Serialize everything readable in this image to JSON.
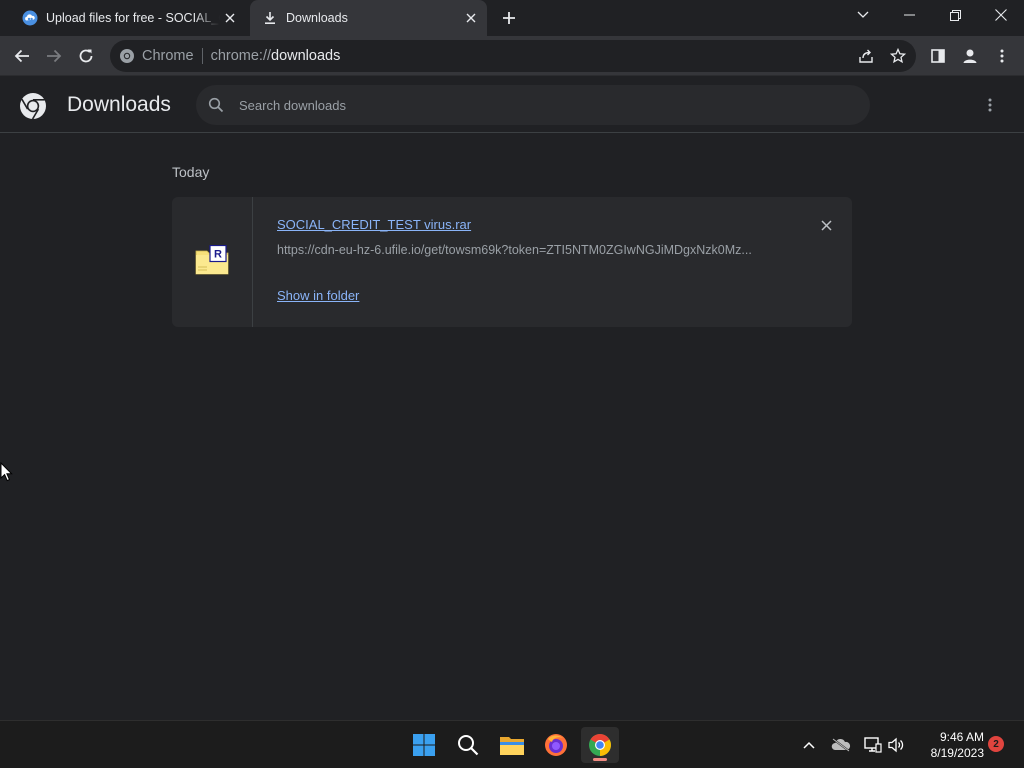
{
  "tabs": [
    {
      "title": "Upload files for free - SOCIAL_CREDIT_TEST virus.rar - ufile.io",
      "favicon": "ufile-cloud-icon",
      "active": false
    },
    {
      "title": "Downloads",
      "favicon": "download-icon",
      "active": true
    }
  ],
  "omnibox": {
    "site_chip": "Chrome",
    "scheme": "chrome://",
    "host": "downloads"
  },
  "page": {
    "title": "Downloads",
    "search_placeholder": "Search downloads"
  },
  "downloads": {
    "date_group": "Today",
    "items": [
      {
        "file_name": "SOCIAL_CREDIT_TEST virus.rar",
        "url": "https://cdn-eu-hz-6.ufile.io/get/towsm69k?token=ZTI5NTM0ZGIwNGJiMDgxNzk0Mz...",
        "action": "Show in folder",
        "file_icon": "rar-archive-icon"
      }
    ]
  },
  "taskbar": {
    "time": "9:46 AM",
    "date": "8/19/2023",
    "notifications": "2"
  },
  "colors": {
    "background": "#202124",
    "toolbar": "#35363a",
    "link": "#8ab4f8",
    "taskbar": "#1c1c1c"
  }
}
